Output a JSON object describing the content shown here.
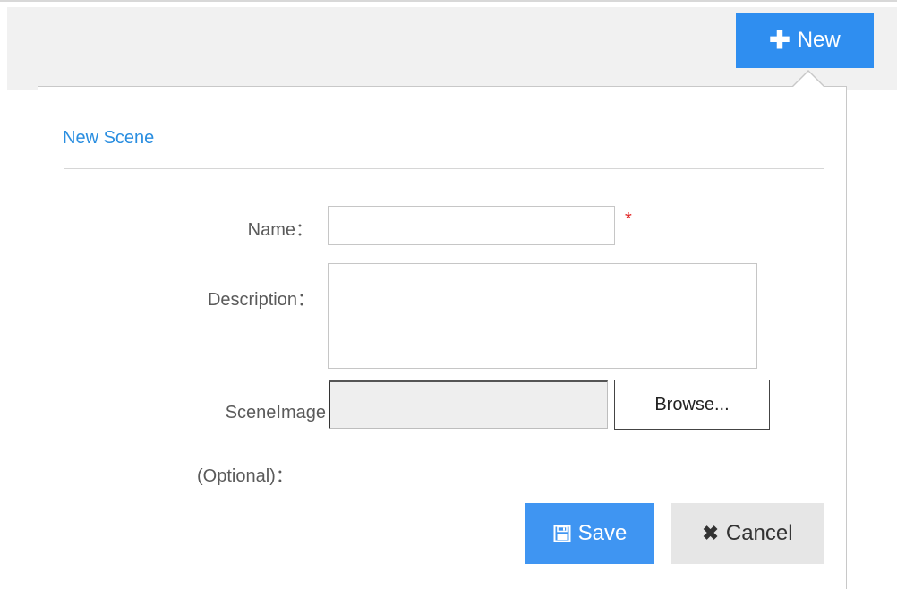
{
  "toolbar": {
    "new_label": "New",
    "new_icon": "plus-icon",
    "accent_color": "#2f8ef0"
  },
  "dialog": {
    "title": "New Scene",
    "fields": {
      "name": {
        "label": "Name：",
        "value": "",
        "required_mark": "*"
      },
      "description": {
        "label": "Description：",
        "value": ""
      },
      "scene_image": {
        "label_line1": "SceneImage",
        "label_line2": "(Optional)：",
        "file_value": "",
        "browse_label": "Browse..."
      }
    },
    "actions": {
      "save_label": "Save",
      "save_icon": "floppy-icon",
      "cancel_label": "Cancel",
      "cancel_icon": "times-icon"
    }
  }
}
